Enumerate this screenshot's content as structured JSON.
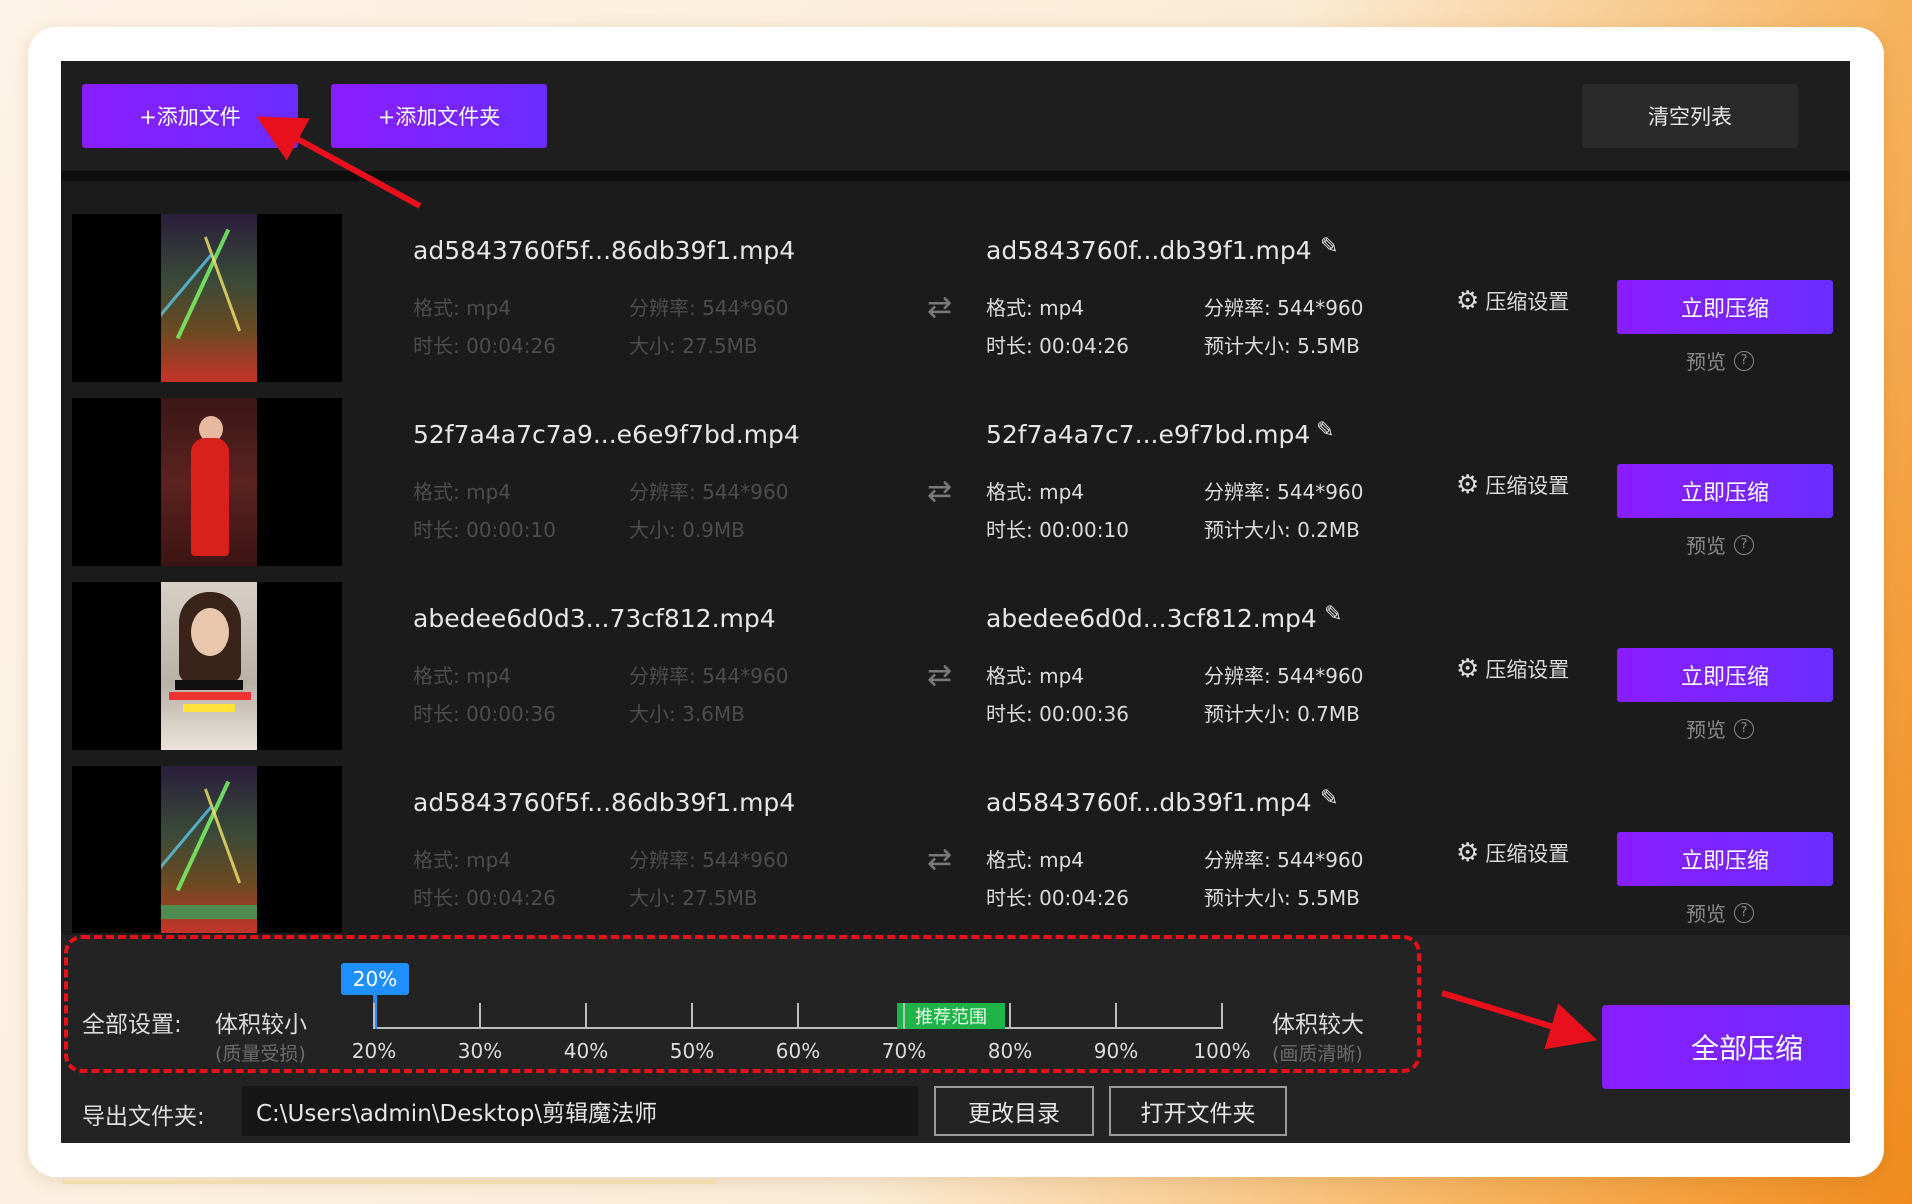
{
  "toolbar": {
    "add_file": "+添加文件",
    "add_folder": "+添加文件夹",
    "clear_list": "清空列表"
  },
  "labels": {
    "format_prefix": "格式: ",
    "resolution_prefix": "分辨率: ",
    "duration_prefix": "时长: ",
    "size_prefix": "大小: ",
    "est_size_prefix": "预计大小: ",
    "settings": "压缩设置",
    "compress_now": "立即压缩",
    "preview": "预览"
  },
  "files": [
    {
      "src_name": "ad5843760f5f...86db39f1.mp4",
      "src_format": "格式: mp4",
      "src_resolution": "分辨率: 544*960",
      "src_duration": "时长: 00:04:26",
      "src_size": "大小: 27.5MB",
      "dst_name": "ad5843760f...db39f1.mp4",
      "dst_format": "格式: mp4",
      "dst_resolution": "分辨率: 544*960",
      "dst_duration": "时长: 00:04:26",
      "dst_size": "预计大小: 5.5MB"
    },
    {
      "src_name": "52f7a4a7c7a9...e6e9f7bd.mp4",
      "src_format": "格式: mp4",
      "src_resolution": "分辨率: 544*960",
      "src_duration": "时长: 00:00:10",
      "src_size": "大小: 0.9MB",
      "dst_name": "52f7a4a7c7...e9f7bd.mp4",
      "dst_format": "格式: mp4",
      "dst_resolution": "分辨率: 544*960",
      "dst_duration": "时长: 00:00:10",
      "dst_size": "预计大小: 0.2MB"
    },
    {
      "src_name": "abedee6d0d3...73cf812.mp4",
      "src_format": "格式: mp4",
      "src_resolution": "分辨率: 544*960",
      "src_duration": "时长: 00:00:36",
      "src_size": "大小: 3.6MB",
      "dst_name": "abedee6d0d...3cf812.mp4",
      "dst_format": "格式: mp4",
      "dst_resolution": "分辨率: 544*960",
      "dst_duration": "时长: 00:00:36",
      "dst_size": "预计大小: 0.7MB"
    },
    {
      "src_name": "ad5843760f5f...86db39f1.mp4",
      "src_format": "格式: mp4",
      "src_resolution": "分辨率: 544*960",
      "src_duration": "时长: 00:04:26",
      "src_size": "大小: 27.5MB",
      "dst_name": "ad5843760f...db39f1.mp4",
      "dst_format": "格式: mp4",
      "dst_resolution": "分辨率: 544*960",
      "dst_duration": "时长: 00:04:26",
      "dst_size": "预计大小: 5.5MB"
    }
  ],
  "global_settings": {
    "label": "全部设置:",
    "small_label": "体积较小",
    "small_sub": "(质量受损)",
    "large_label": "体积较大",
    "large_sub": "(画质清晰)",
    "current_value": "20%",
    "recommended": "推荐范围",
    "ticks": [
      "20%",
      "30%",
      "40%",
      "50%",
      "60%",
      "70%",
      "80%",
      "90%",
      "100%"
    ]
  },
  "compress_all": "全部压缩",
  "export": {
    "label": "导出文件夹:",
    "path": "C:\\Users\\admin\\Desktop\\剪辑魔法师",
    "change_dir": "更改目录",
    "open_folder": "打开文件夹"
  },
  "colors": {
    "accent_purple": "#7a24ff",
    "slider_blue": "#1e90ff",
    "recommend_green": "#1fb34a",
    "annotation_red": "#e8101c"
  }
}
